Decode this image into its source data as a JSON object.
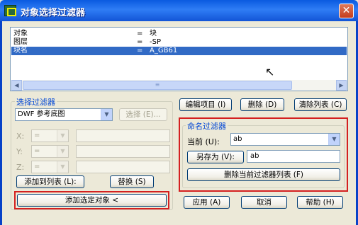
{
  "window": {
    "title": "对象选择过滤器",
    "close_glyph": "✕"
  },
  "filter_list": {
    "rows": [
      {
        "name": "对象",
        "op": "=",
        "value": "块",
        "selected": false
      },
      {
        "name": "图层",
        "op": "=",
        "value": "-SP",
        "selected": false
      },
      {
        "name": "块名",
        "op": "=",
        "value": "A_GB61",
        "selected": true
      }
    ]
  },
  "select_filter": {
    "group_title": "选择过滤器",
    "type_value": "DWF 参考底图",
    "select_button": "选择 (E)...",
    "x_label": "X:",
    "y_label": "Y:",
    "z_label": "Z:",
    "x_op": "=",
    "y_op": "=",
    "z_op": "=",
    "add_to_list_button": "添加到列表 (L):",
    "replace_button": "替换 (S)",
    "add_selected_button": "添加选定对象 <"
  },
  "list_actions": {
    "edit_button": "编辑项目 (I)",
    "delete_button": "删除 (D)",
    "clear_button": "清除列表 (C)"
  },
  "named_filters": {
    "group_title": "命名过滤器",
    "current_label": "当前 (U):",
    "current_value": "ab",
    "save_as_button": "另存为 (V):",
    "save_as_value": "ab",
    "delete_current_button": "删除当前过滤器列表 (F)"
  },
  "footer": {
    "apply_button": "应用 (A)",
    "cancel_button": "取消",
    "help_button": "帮助 (H)"
  },
  "highlight_color": "#d42020",
  "selection_color": "#316ac5"
}
